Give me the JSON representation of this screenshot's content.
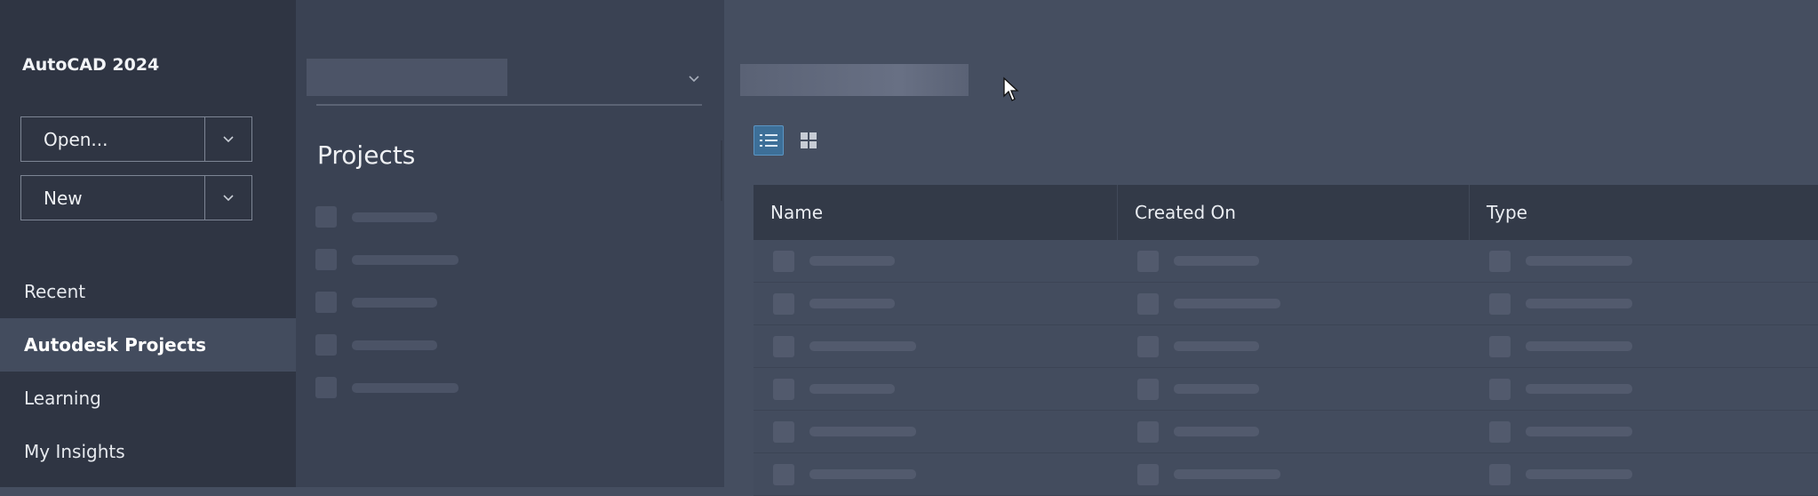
{
  "sidebar": {
    "app_title": "AutoCAD 2024",
    "open_label": "Open...",
    "new_label": "New",
    "nav": [
      "Recent",
      "Autodesk Projects",
      "Learning",
      "My Insights"
    ],
    "active_nav": "Autodesk Projects"
  },
  "middle": {
    "title": "Projects"
  },
  "main": {
    "table_headers": [
      "Name",
      "Created On",
      "Type"
    ],
    "active_view": "list"
  },
  "colors": {
    "sidebar_bg": "#2f3543",
    "accent": "#3d6f98"
  },
  "icons": [
    "chevron-down-icon",
    "list-view-icon",
    "grid-view-icon",
    "mouse-cursor-icon"
  ]
}
